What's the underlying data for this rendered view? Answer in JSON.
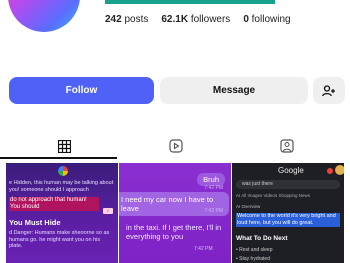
{
  "profile": {
    "stats": {
      "posts_count": "242",
      "posts_label": "posts",
      "followers_count": "62.1K",
      "followers_label": "followers",
      "following_count": "0",
      "following_label": "following"
    }
  },
  "actions": {
    "follow_label": "Follow",
    "message_label": "Message"
  },
  "tabs": [
    {
      "name": "posts-grid",
      "icon": "grid-icon",
      "selected": true
    },
    {
      "name": "reels",
      "icon": "reels-icon",
      "selected": false
    },
    {
      "name": "tagged",
      "icon": "tagged-icon",
      "selected": false
    }
  ],
  "colors": {
    "follow_button": "#4f61f7",
    "secondary_button": "#efefef",
    "accent_bar": "#17a38b"
  },
  "posts": [
    {
      "lines": [
        "e Hidden, this human may be talking about you! someone should I approach",
        "do not approach that human! You should",
        "You Must Hide",
        "d Danger: Humans make sheoorne so as humans go. he might want you on his plate."
      ],
      "chip": "✓"
    },
    {
      "bubble1": "Bruh",
      "time1": "7:42 PM",
      "bubble2": "I need my car now I have to leave",
      "time2": "7:42 PM",
      "bubble3": "in the taxi. If I get there, I'll in everything to you",
      "time3": "7:42 PM"
    },
    {
      "brand": "Google",
      "query": "was just there",
      "categories": "AI   All   Images   Videos   Shopping   News",
      "ai_label": "AI Overview",
      "highlight": "Welcome to the world it's very bright and loud here, but you will do great.",
      "heading": "What To Do Next",
      "step1": "• Rest and sleep",
      "step2": "• Stay hydrated"
    }
  ]
}
